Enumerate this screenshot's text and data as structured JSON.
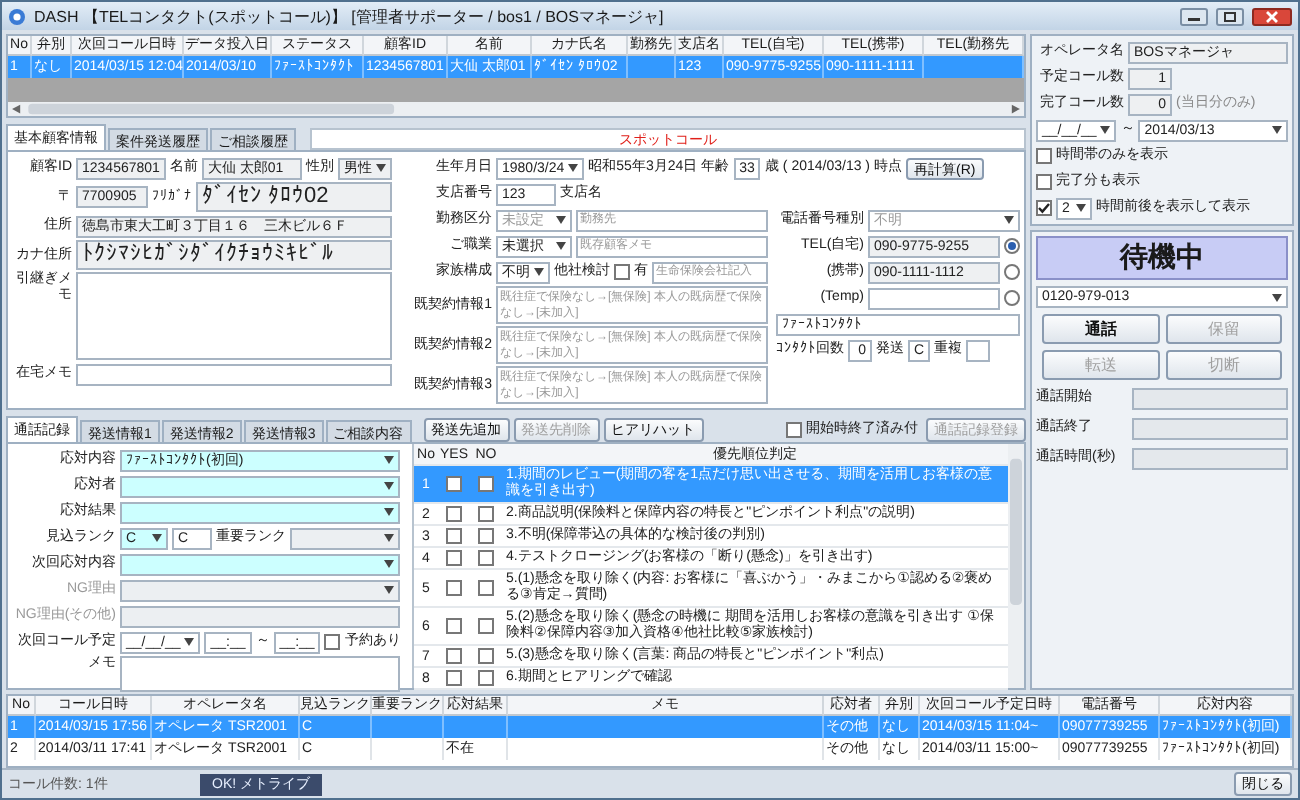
{
  "window": {
    "title": "DASH 【TELコンタクト(スポットコール)】 [管理者サポーター / bos1 / BOSマネージャ]"
  },
  "call_list": {
    "columns": [
      "No",
      "弁別",
      "次回コール日時",
      "データ投入日",
      "ステータス",
      "顧客ID",
      "名前",
      "カナ氏名",
      "勤務先",
      "支店名",
      "TEL(自宅)",
      "TEL(携帯)",
      "TEL(勤務先"
    ],
    "rows": [
      {
        "selected": true,
        "cells": [
          "1",
          "なし",
          "2014/03/15 12:04",
          "2014/03/10",
          "ﾌｧｰｽﾄｺﾝﾀｸﾄ",
          "1234567801",
          "大仙 太郎01",
          "ﾀﾞｲｾﾝ ﾀﾛｳ02",
          null,
          "123",
          "090-9775-9255",
          "090-1111-1111",
          null
        ]
      }
    ]
  },
  "operator_panel": {
    "fields": [
      {
        "label": "オペレータ名",
        "value": "BOSマネージャ"
      },
      {
        "label": "予定コール数",
        "value": "1"
      },
      {
        "label": "完了コール数",
        "value": "0",
        "note": "(当日分のみ)"
      }
    ],
    "date_from": "__/__/__",
    "separator": "～",
    "date_to": "2014/03/13",
    "options": [
      {
        "label": "時間帯のみを表示",
        "checked": false
      },
      {
        "label": "完了分も表示",
        "checked": false
      }
    ],
    "hours_filter": {
      "checked": true,
      "value": "2",
      "label": "時間前後を表示して表示"
    }
  },
  "customer": {
    "tabs": [
      {
        "label": "基本顧客情報",
        "selected": true
      },
      {
        "label": "案件発送履歴",
        "selected": false
      },
      {
        "label": "ご相談履歴",
        "selected": false
      }
    ],
    "banner": "スポットコール",
    "customer_id": {
      "label": "顧客ID",
      "value": "1234567801"
    },
    "name": {
      "label": "名前",
      "value": "大仙 太郎01"
    },
    "gender": {
      "label": "性別",
      "value": "男性"
    },
    "postal": {
      "label": "〒",
      "value": "7700905"
    },
    "furigana": {
      "label": "ﾌﾘｶﾞﾅ",
      "value": "ﾀﾞｲｾﾝ ﾀﾛｳ02"
    },
    "address": {
      "label": "住所",
      "value": "徳島市東大工町３丁目１６　三木ビル６Ｆ"
    },
    "kana_address": {
      "label": "カナ住所",
      "value": "ﾄｸｼﾏｼﾋｶﾞｼﾀﾞｲｸﾁｮｳﾐｷﾋﾞﾙ"
    },
    "handover_memo": {
      "label": "引継ぎメモ"
    },
    "home_memo": {
      "label": "在宅メモ"
    },
    "birth_date": {
      "label": "生年月日",
      "value": "1980/3/24",
      "era": "昭和55年3月24日",
      "age_label": "年齢",
      "age": "33",
      "age_unit": "歳",
      "as_of": "( 2014/03/13 )",
      "as_of_label": "時点",
      "button": "再計算(R)"
    },
    "branch": {
      "label": "支店番号",
      "value": "123",
      "name_label": "支店名"
    },
    "employment": {
      "label": "勤務区分",
      "value": "未設定",
      "placeholder": "勤務先"
    },
    "occupation": {
      "label": "ご職業",
      "value": "未選択",
      "placeholder": "既存顧客メモ"
    },
    "family": {
      "label": "家族構成",
      "value": "不明",
      "competitor_label": "他社検討",
      "competitor_checked": false,
      "has_label": "有",
      "placeholder": "生命保険会社記入"
    },
    "contracts": [
      {
        "label": "既契約情報1",
        "placeholder": "既往症で保険なし→[無保険] 本人の既病歴で保険なし→[未加入]"
      },
      {
        "label": "既契約情報2",
        "placeholder": "既往症で保険なし→[無保険] 本人の既病歴で保険なし→[未加入]"
      },
      {
        "label": "既契約情報3",
        "placeholder": "既往症で保険なし→[無保険] 本人の既病歴で保険なし→[未加入]"
      }
    ],
    "phone_type": {
      "label": "電話番号種別",
      "value": "不明"
    },
    "phones": [
      {
        "label": "TEL(自宅)",
        "value": "090-9775-9255",
        "selected": true
      },
      {
        "label": "(携帯)",
        "value": "090-1111-1112",
        "selected": false
      },
      {
        "label": "(Temp)",
        "selected": false
      }
    ],
    "status_value": "ﾌｧｰｽﾄｺﾝﾀｸﾄ",
    "contact_count": {
      "label": "ｺﾝﾀｸﾄ回数",
      "value": "0"
    },
    "ship": {
      "label": "発送",
      "value": "C"
    },
    "duplicate": {
      "label": "重複"
    }
  },
  "call_status": {
    "state": "待機中",
    "line": "0120-979-013",
    "buttons": [
      {
        "label": "通話",
        "disabled": false
      },
      {
        "label": "保留",
        "disabled": true
      },
      {
        "label": "転送",
        "disabled": true
      },
      {
        "label": "切断",
        "disabled": true
      }
    ],
    "timers": [
      {
        "label": "通話開始"
      },
      {
        "label": "通話終了"
      },
      {
        "label": "通話時間(秒)"
      }
    ]
  },
  "call_record": {
    "tabs": [
      {
        "label": "通話記録",
        "selected": true
      },
      {
        "label": "発送情報1",
        "selected": false
      },
      {
        "label": "発送情報2",
        "selected": false
      },
      {
        "label": "発送情報3",
        "selected": false
      },
      {
        "label": "ご相談内容",
        "selected": false
      }
    ],
    "actions": [
      {
        "label": "発送先追加",
        "disabled": false
      },
      {
        "label": "発送先削除",
        "disabled": true
      },
      {
        "label": "ヒアリハット",
        "disabled": false
      }
    ],
    "end_option": {
      "label": "開始時終了済み付",
      "checked": false
    },
    "register_button": {
      "label": "通話記録登録",
      "disabled": true
    },
    "form": [
      {
        "kind": "select",
        "label": "応対内容",
        "value": "ﾌｧｰｽﾄｺﾝﾀｸﾄ(初回)"
      },
      {
        "kind": "select",
        "label": "応対者"
      },
      {
        "kind": "select",
        "label": "応対結果"
      },
      {
        "kind": "rank",
        "label": "見込ランク",
        "value": "C",
        "value2": "C",
        "label2": "重要ランク"
      },
      {
        "kind": "select",
        "label": "次回応対内容"
      },
      {
        "kind": "select",
        "label": "NG理由",
        "disabled": true
      },
      {
        "kind": "text",
        "label": "NG理由(その他)",
        "disabled": true
      },
      {
        "kind": "schedule",
        "label": "次回コール予定",
        "date": "__/__/__",
        "time_from": "__:__",
        "separator": "～",
        "time_to": "__:__",
        "check_label": "予約あり",
        "checked": false
      },
      {
        "kind": "memo",
        "label": "メモ"
      }
    ],
    "checklist": {
      "columns": [
        "No",
        "YES",
        "NO",
        "優先順位判定"
      ],
      "rows": [
        {
          "no": "1",
          "yes": false,
          "no_mark": false,
          "selected": true,
          "text": "1.期間のレビュー(期間の客を1点だけ思い出させる、期間を活用しお客様の意識を引き出す)"
        },
        {
          "no": "2",
          "yes": false,
          "no_mark": false,
          "selected": false,
          "text": "2.商品説明(保険料と保障内容の特長と\"ピンポイント利点\"の説明)"
        },
        {
          "no": "3",
          "yes": false,
          "no_mark": false,
          "selected": false,
          "text": "3.不明(保障帯込の具体的な検討後の判別)"
        },
        {
          "no": "4",
          "yes": false,
          "no_mark": false,
          "selected": false,
          "text": "4.テストクロージング(お客様の「断り(懸念)」を引き出す)"
        },
        {
          "no": "5",
          "yes": false,
          "no_mark": false,
          "selected": false,
          "text": "5.(1)懸念を取り除く(内容: お客様に「喜ぶかう」・みまこから①認める②褒める③肯定→質問)"
        },
        {
          "no": "6",
          "yes": false,
          "no_mark": false,
          "selected": false,
          "text": "5.(2)懸念を取り除く(懸念の時機に 期間を活用しお客様の意識を引き出す ①保険料②保障内容③加入資格④他社比較⑤家族検討)"
        },
        {
          "no": "7",
          "yes": false,
          "no_mark": false,
          "selected": false,
          "text": "5.(3)懸念を取り除く(言葉: 商品の特長と\"ピンポイント\"利点)"
        },
        {
          "no": "8",
          "yes": false,
          "no_mark": false,
          "selected": false,
          "text": "6.期間とヒアリングで確認"
        }
      ]
    }
  },
  "history": {
    "columns": [
      "No",
      "コール日時",
      "オペレータ名",
      "見込ランク",
      "重要ランク",
      "応対結果",
      "メモ",
      "応対者",
      "弁別",
      "次回コール予定日時",
      "電話番号",
      "応対内容"
    ],
    "rows": [
      {
        "selected": true,
        "cells": [
          "1",
          "2014/03/15 17:56",
          "オペレータ TSR2001",
          "C",
          null,
          null,
          null,
          "その他",
          "なし",
          "2014/03/15 11:04~",
          "09077739255",
          "ﾌｧｰｽﾄｺﾝﾀｸﾄ(初回)"
        ]
      },
      {
        "selected": false,
        "cells": [
          "2",
          "2014/03/11 17:41",
          "オペレータ TSR2001",
          "C",
          null,
          "不在",
          null,
          "その他",
          "なし",
          "2014/03/11 15:00~",
          "09077739255",
          "ﾌｧｰｽﾄｺﾝﾀｸﾄ(初回)"
        ]
      }
    ]
  },
  "status_bar": {
    "count": "コール件数: 1件",
    "message": "OK! メトライブ",
    "close_button": "閉じる"
  }
}
